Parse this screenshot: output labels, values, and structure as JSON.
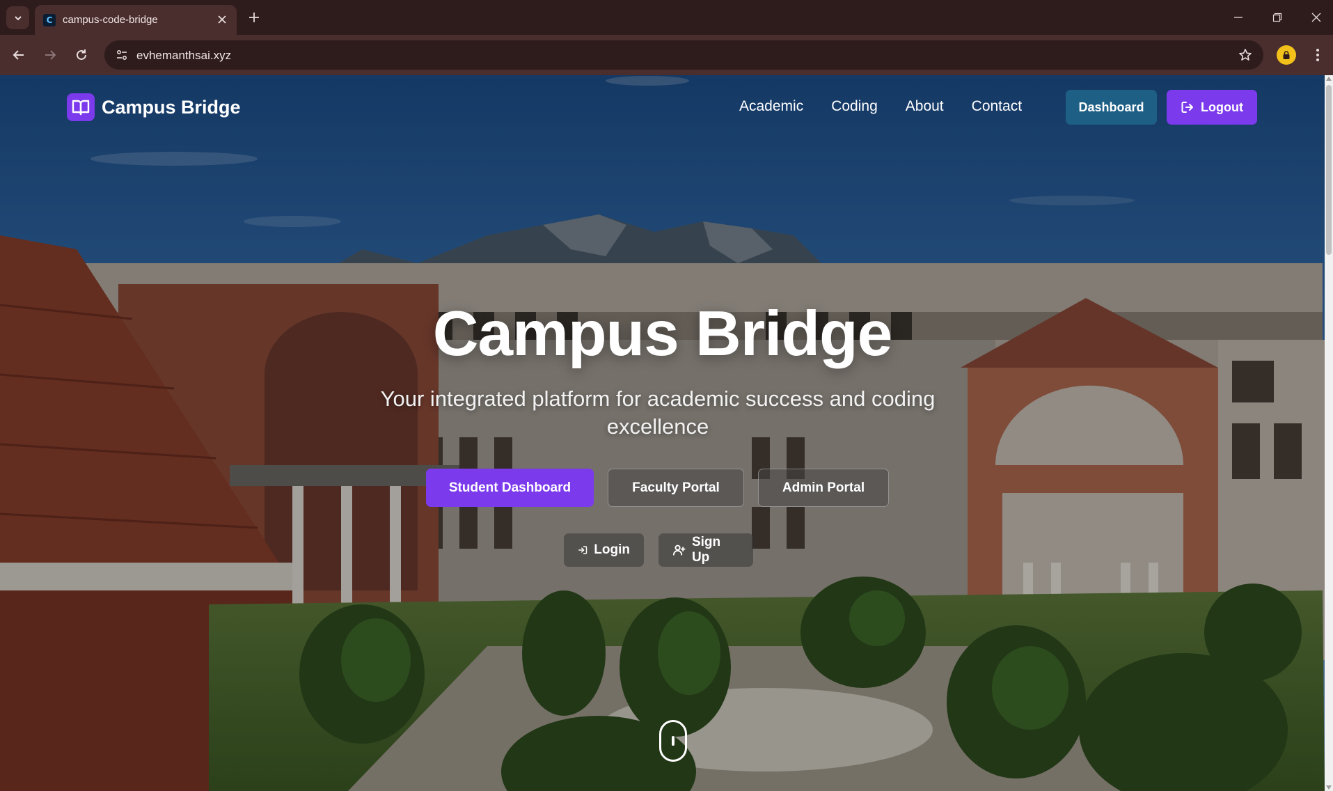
{
  "browser": {
    "tab_title": "campus-code-bridge",
    "tab_favicon_letter": "C",
    "url": "evhemanthsai.xyz",
    "icons": {
      "tab_menu": "chevron-down-icon",
      "close_tab": "close-icon",
      "new_tab": "plus-icon",
      "back": "arrow-left-icon",
      "forward": "arrow-right-icon",
      "reload": "reload-icon",
      "site_info": "site-settings-icon",
      "bookmark": "star-icon",
      "profile": "profile-icon",
      "menu": "kebab-menu-icon",
      "minimize": "minimize-icon",
      "restore": "restore-icon",
      "close_window": "close-icon"
    }
  },
  "site": {
    "brand": "Campus Bridge",
    "nav": [
      "Academic",
      "Coding",
      "About",
      "Contact"
    ],
    "dashboard_label": "Dashboard",
    "logout_label": "Logout"
  },
  "hero": {
    "title": "Campus Bridge",
    "subtitle": "Your integrated platform for academic success and coding excellence",
    "actions": [
      "Student Dashboard",
      "Faculty Portal",
      "Admin Portal"
    ],
    "login_label": "Login",
    "signup_label": "Sign Up"
  },
  "colors": {
    "accent": "#7c3aed",
    "dashboard_button": "#1e5f86",
    "chrome_dark": "#2e1b1b",
    "chrome_toolbar": "#4a2d2d"
  }
}
